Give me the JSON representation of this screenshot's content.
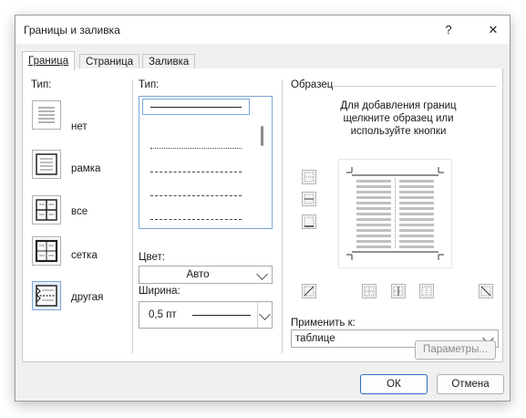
{
  "window": {
    "title": "Границы и заливка",
    "help": "?",
    "close": "✕"
  },
  "tabs": [
    {
      "label": "Граница",
      "active": true
    },
    {
      "label": "Страница",
      "active": false
    },
    {
      "label": "Заливка",
      "active": false
    }
  ],
  "setting": {
    "label": "Тип:",
    "items": [
      {
        "label": "нет",
        "icon": "border-none-icon",
        "selected": false
      },
      {
        "label": "рамка",
        "icon": "border-box-icon",
        "selected": false
      },
      {
        "label": "все",
        "icon": "border-all-icon",
        "selected": false
      },
      {
        "label": "сетка",
        "icon": "border-grid-icon",
        "selected": false
      },
      {
        "label": "другая",
        "icon": "border-custom-icon",
        "selected": true
      }
    ]
  },
  "style": {
    "label": "Тип:",
    "color_label": "Цвет:",
    "color_value": "Авто",
    "width_label": "Ширина:",
    "width_value": "0,5 пт"
  },
  "preview": {
    "label": "Образец",
    "hint": "Для добавления границ щелкните образец или используйте кнопки"
  },
  "apply_to": {
    "label": "Применить к:",
    "value": "таблице"
  },
  "buttons": {
    "options": "Параметры...",
    "ok": "ОК",
    "cancel": "Отмена"
  },
  "colors": {
    "accent": "#2a6ec3",
    "selection": "#e5eefa"
  }
}
